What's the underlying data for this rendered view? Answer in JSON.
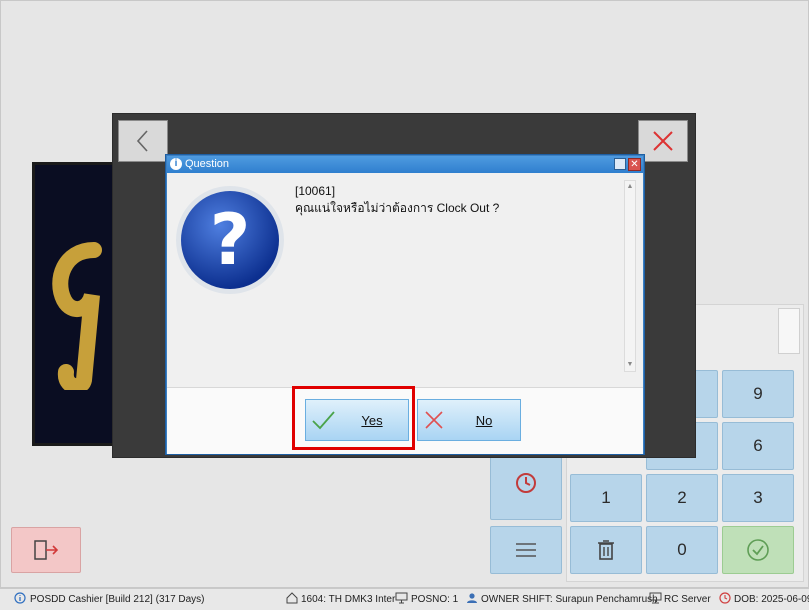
{
  "dialog": {
    "title": "Question",
    "code": "[10061]",
    "message": "คุณแน่ใจหรือไม่ว่าต้องการ Clock Out ?",
    "yes_label": "Yes",
    "no_label": "No"
  },
  "keypad": {
    "keys": [
      "9",
      "6",
      "1",
      "2",
      "3",
      "0"
    ]
  },
  "statusbar": {
    "app": "POSDD Cashier [Build 212] (317 Days)",
    "branch": "1604: TH DMK3 Inter",
    "posno": "POSNO: 1",
    "shift": "OWNER SHIFT: Surapun Penchamrush",
    "server": "RC Server",
    "dob": "DOB: 2025-06-09"
  },
  "colors": {
    "accent": "#2f7fcf",
    "highlight": "#e00000",
    "key": "#b7d5ea",
    "confirm_key": "#bfe0b8"
  },
  "icons": [
    "back-icon",
    "close-icon",
    "question-icon",
    "checkmark-icon",
    "x-icon",
    "clock-icon",
    "menu-icon",
    "trash-icon",
    "check-circle-icon",
    "exit-icon",
    "info-icon",
    "home-icon",
    "monitor-icon",
    "user-icon",
    "server-icon",
    "clock-small-icon"
  ]
}
